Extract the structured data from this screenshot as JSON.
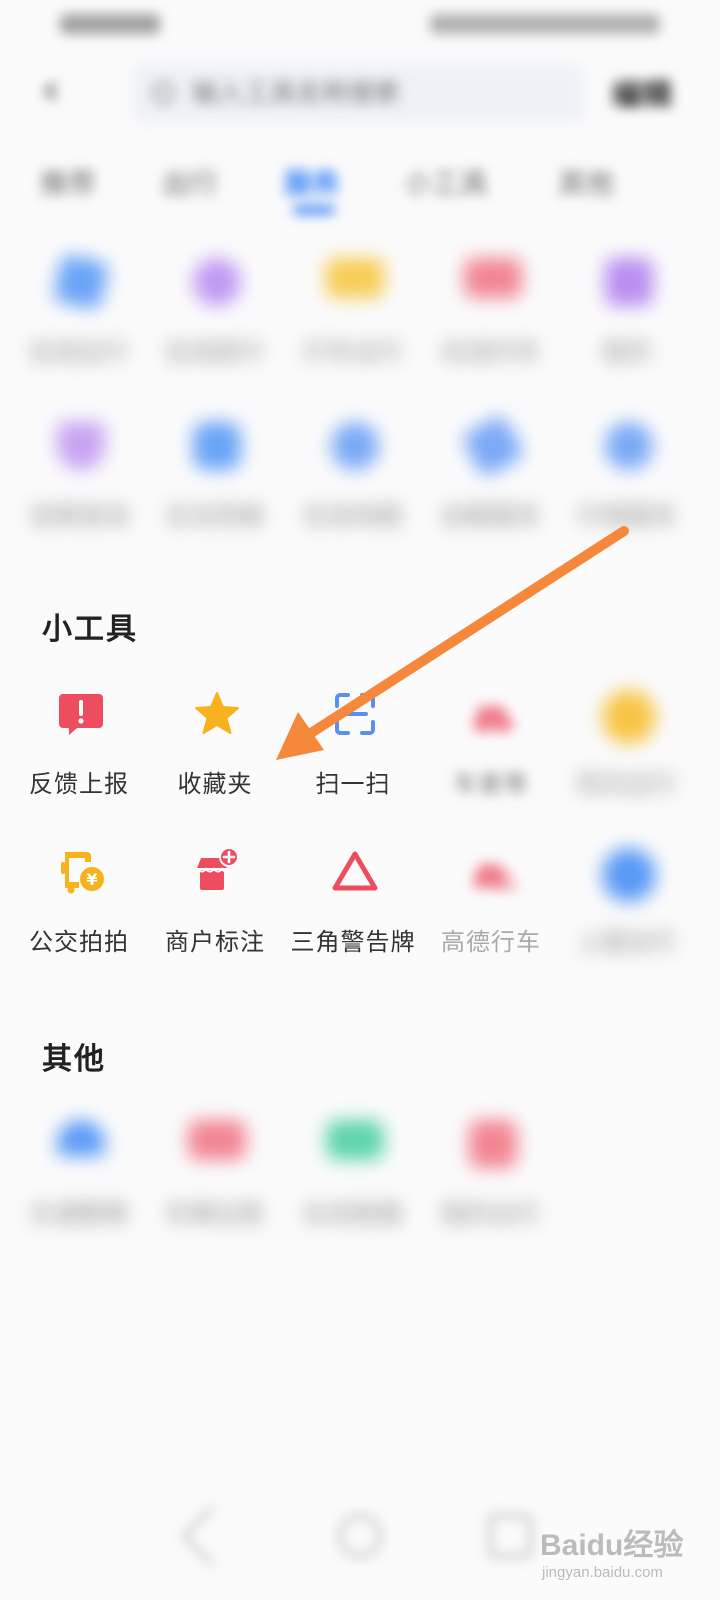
{
  "header": {
    "search_placeholder": "输入工具名称搜索",
    "edit_label": "编辑"
  },
  "tabs": [
    {
      "label": "推荐"
    },
    {
      "label": "出行"
    },
    {
      "label": "服务"
    },
    {
      "label": "小工具"
    },
    {
      "label": "其他"
    }
  ],
  "services_row1": [
    {
      "label": "在线出行",
      "color": "#4a90f5"
    },
    {
      "label": "在线旅行",
      "color": "#b78af0"
    },
    {
      "label": "打车出行",
      "color": "#f6c545"
    },
    {
      "label": "在线约车",
      "color": "#f06d7a"
    },
    {
      "label": "我的",
      "color": "#b07ef0"
    }
  ],
  "services_row2": [
    {
      "label": "违章查询",
      "color": "#b98ef0"
    },
    {
      "label": "互动贡献",
      "color": "#4a90f5"
    },
    {
      "label": "在线地图",
      "color": "#5a9af5"
    },
    {
      "label": "加载服务",
      "color": "#5a9af5"
    },
    {
      "label": "行程服务",
      "color": "#5a9af5"
    }
  ],
  "tools_section": {
    "title": "小工具",
    "row1": [
      {
        "label": "反馈上报",
        "icon": "feedback-alert-icon",
        "color": "#ee4d5f"
      },
      {
        "label": "收藏夹",
        "icon": "star-icon",
        "color": "#f7b21d"
      },
      {
        "label": "扫一扫",
        "icon": "scan-icon",
        "color": "#5a8ff0"
      },
      {
        "label": "车差等",
        "icon": "car-icon",
        "color": "#f07f8d"
      },
      {
        "label": "阳光出行",
        "icon": "sun-icon",
        "color": "#f7c545"
      }
    ],
    "row2": [
      {
        "label": "公交拍拍",
        "icon": "bus-yuan-icon",
        "color": "#f7b21d"
      },
      {
        "label": "商户标注",
        "icon": "shop-plus-icon",
        "color": "#ee4d5f"
      },
      {
        "label": "三角警告牌",
        "icon": "warning-triangle-icon",
        "color": "#ee4d5f"
      },
      {
        "label": "高德行车",
        "icon": "car-warning-icon",
        "color": "#f07f8d"
      },
      {
        "label": "上报出行",
        "icon": "circle-icon",
        "color": "#4a90f5"
      }
    ]
  },
  "other_section": {
    "title": "其他",
    "items": [
      {
        "label": "交通警察",
        "icon": "police-cap-icon",
        "color": "#4a90f5"
      },
      {
        "label": "车辆出售",
        "icon": "car-bag-icon",
        "color": "#f07f8d"
      },
      {
        "label": "在线客服",
        "icon": "phone-icon",
        "color": "#4dcfa6"
      },
      {
        "label": "我的出行",
        "icon": "square-icon",
        "color": "#f07f8d"
      }
    ]
  },
  "watermark": {
    "brand": "Baidu经验",
    "url": "jingyan.baidu.com"
  }
}
